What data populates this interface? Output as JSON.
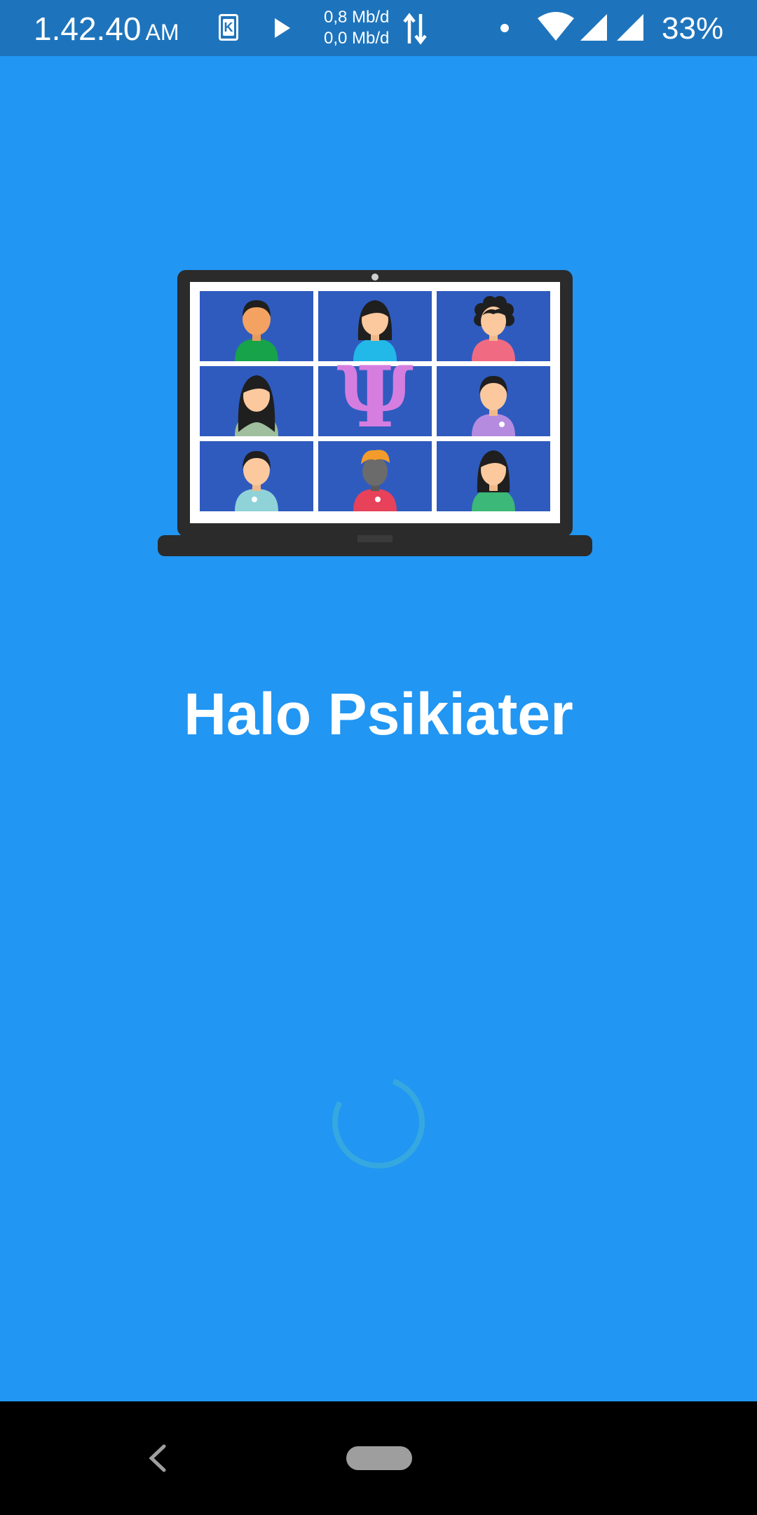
{
  "status_bar": {
    "time": "1.42.40",
    "ampm": "AM",
    "speed_up": "0,8 Mb/d",
    "speed_down": "0,0 Mb/d",
    "battery": "33%",
    "icons": [
      "k-app-icon",
      "play-icon",
      "data-arrows-icon",
      "dot-icon",
      "wifi-icon",
      "signal-icon",
      "signal-icon",
      "battery-text"
    ]
  },
  "app": {
    "title": "Halo Psikiater",
    "background_color": "#2196f3",
    "status_bar_color": "#1e74bc"
  },
  "illustration": {
    "name": "laptop-video-call-illustration",
    "symbol": "Ψ"
  },
  "nav_bar": {
    "icons": [
      "back-icon",
      "home-pill"
    ]
  }
}
